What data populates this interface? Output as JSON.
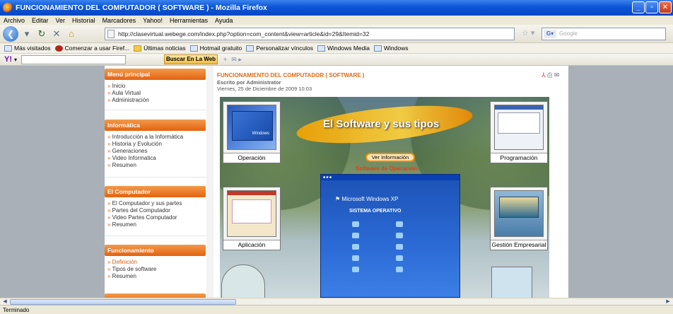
{
  "window": {
    "title": "FUNCIONAMIENTO DEL COMPUTADOR ( SOFTWARE ) - Mozilla Firefox"
  },
  "menu": [
    "Archivo",
    "Editar",
    "Ver",
    "Historial",
    "Marcadores",
    "Yahoo!",
    "Herramientas",
    "Ayuda"
  ],
  "nav": {
    "url": "http://clasevirtual.webege.com/index.php?option=com_content&view=article&id=29&Itemid=32",
    "search_placeholder": "Google"
  },
  "bookmarks": [
    {
      "label": "Más visitados",
      "icon": "mostvisited-icon"
    },
    {
      "label": "Comenzar a usar Firef...",
      "icon": "firefox-icon"
    },
    {
      "label": "Últimas noticias",
      "icon": "rss-icon"
    },
    {
      "label": "Hotmail gratuito",
      "icon": "page-icon"
    },
    {
      "label": "Personalizar vínculos",
      "icon": "page-icon"
    },
    {
      "label": "Windows Media",
      "icon": "page-icon"
    },
    {
      "label": "Windows",
      "icon": "page-icon"
    }
  ],
  "yahoo": {
    "logo": "Y!",
    "search_button": "Buscar En La Web"
  },
  "sidebar": {
    "sections": [
      {
        "title": "Menú principal",
        "items": [
          "Inicio",
          "Aula Virtual",
          "Administración"
        ]
      },
      {
        "title": "Informática",
        "items": [
          "Introducción a la Informática",
          "Historia y Evolución",
          "Generaciones",
          "Video Informatica",
          "Resumen"
        ]
      },
      {
        "title": "El Computador",
        "items": [
          "El Computador y sus partes",
          "Partes del Computador",
          "Video Partes Computador",
          "Resumen"
        ]
      },
      {
        "title": "Funcionamiento",
        "items": [
          "Definición",
          "Tipos de software",
          "Resumen"
        ]
      }
    ]
  },
  "article": {
    "title": "FUNCIONAMIENTO DEL COMPUTADOR ( SOFTWARE )",
    "author": "Escrito por Administrator",
    "date": "Viernes, 25 de Diciembre de 2009 10:03"
  },
  "banner": {
    "title": "El Software y sus tipos",
    "button": "Ver Información",
    "subtitle": "Software de Operación",
    "cards": [
      "Operación",
      "Programación",
      "Aplicación",
      "Gestión Empresarial"
    ],
    "xp_logo": "Microsoft Windows XP",
    "xp_subtitle": "SISTEMA OPERATIVO"
  },
  "status": {
    "text": "Terminado"
  }
}
